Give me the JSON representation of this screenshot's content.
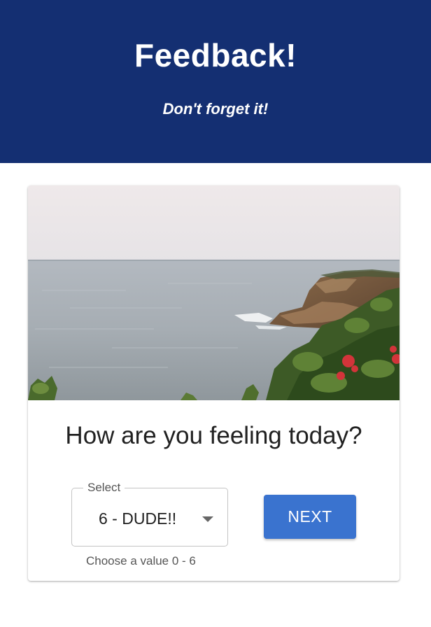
{
  "header": {
    "title": "Feedback!",
    "subtitle": "Don't forget it!",
    "background_color": "#142f72"
  },
  "card": {
    "image": {
      "subject": "sea coast with rocky cliff and red flowers",
      "icon": "landscape-photo"
    },
    "question": "How are you feeling today?",
    "select": {
      "label": "Select",
      "value": "6 - DUDE!!",
      "helper_text": "Choose a value 0 - 6",
      "icon": "dropdown-arrow-icon"
    },
    "next_button": {
      "label": "NEXT",
      "color": "#3a73cf"
    }
  }
}
